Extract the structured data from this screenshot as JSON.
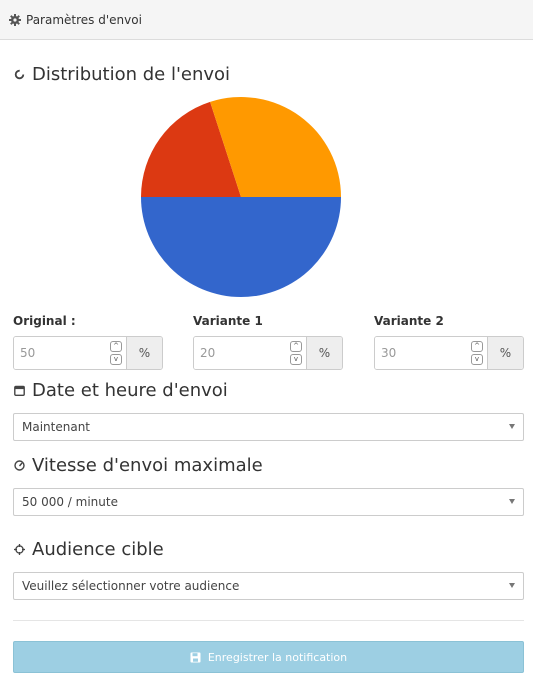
{
  "header": {
    "title": "Paramètres d'envoi",
    "icon": "gear-icon"
  },
  "distribution": {
    "title": "Distribution de l'envoi",
    "icon": "circle-notch-icon",
    "chart_data": {
      "type": "pie",
      "labels": [
        "Original :",
        "Variante 1",
        "Variante 2"
      ],
      "values": [
        50,
        20,
        30
      ],
      "colors": [
        "#3366cc",
        "#dc3912",
        "#ff9900"
      ]
    },
    "fields": [
      {
        "label": "Original :",
        "value": "50",
        "unit": "%"
      },
      {
        "label": "Variante 1",
        "value": "20",
        "unit": "%"
      },
      {
        "label": "Variante 2",
        "value": "30",
        "unit": "%"
      }
    ]
  },
  "date": {
    "title": "Date et heure d'envoi",
    "icon": "calendar-icon",
    "selected": "Maintenant"
  },
  "speed": {
    "title": "Vitesse d'envoi maximale",
    "icon": "gauge-icon",
    "selected": "50 000 / minute"
  },
  "audience": {
    "title": "Audience cible",
    "icon": "crosshair-icon",
    "selected": "Veuillez sélectionner votre audience"
  },
  "save_button": {
    "label": "Enregistrer la notification",
    "icon": "floppy-disk-icon",
    "color": "#9dcfe3"
  }
}
